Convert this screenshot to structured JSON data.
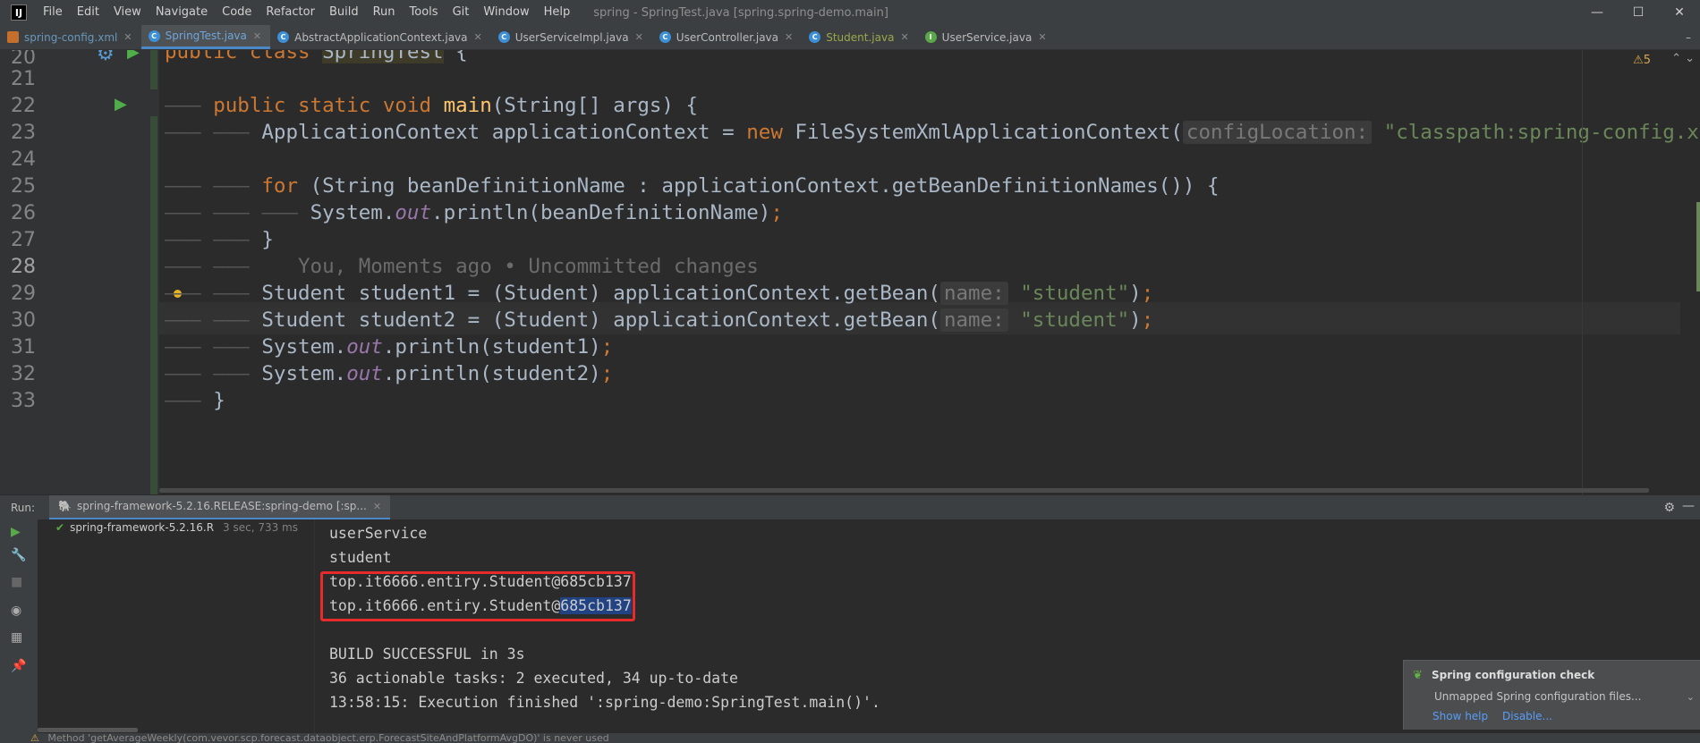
{
  "app": {
    "logo": "IJ",
    "window_title": "spring - SpringTest.java [spring.spring-demo.main]",
    "menu": [
      "File",
      "Edit",
      "View",
      "Navigate",
      "Code",
      "Refactor",
      "Build",
      "Run",
      "Tools",
      "Git",
      "Window",
      "Help"
    ],
    "controls": {
      "minimize": "—",
      "maximize": "☐",
      "close": "✕"
    }
  },
  "tabs": [
    {
      "label": "spring-config.xml",
      "icon": "xml-file-icon",
      "style": "blue",
      "glyph": ""
    },
    {
      "label": "SpringTest.java",
      "icon": "class-icon",
      "style": "active",
      "glyph": "C"
    },
    {
      "label": "AbstractApplicationContext.java",
      "icon": "class-icon",
      "style": "normal",
      "glyph": "C"
    },
    {
      "label": "UserServiceImpl.java",
      "icon": "class-icon",
      "style": "normal",
      "glyph": "C"
    },
    {
      "label": "UserController.java",
      "icon": "class-icon",
      "style": "normal",
      "glyph": "C"
    },
    {
      "label": "Student.java",
      "icon": "class-icon",
      "style": "green",
      "glyph": "C"
    },
    {
      "label": "UserService.java",
      "icon": "interface-icon",
      "style": "normal",
      "glyph": "I"
    }
  ],
  "editor": {
    "warnings": "⚠5",
    "line_numbers": [
      "20",
      "21",
      "22",
      "23",
      "24",
      "25",
      "26",
      "27",
      "28",
      "29",
      "30",
      "31",
      "32",
      "33"
    ],
    "current_line": "28",
    "blame": "You, Moments ago • Uncommitted changes",
    "hints": {
      "config_location": "configLocation:",
      "name": "name:"
    },
    "strings": {
      "classpath": "\"classpath:spring-config.xml\"",
      "student": "\"student\""
    }
  },
  "run": {
    "label": "Run:",
    "tab_label": "spring-framework-5.2.16.RELEASE:spring-demo [:sp...",
    "tree_item": "spring-framework-5.2.16.R",
    "tree_time": "3 sec, 733 ms",
    "console_lines": [
      "userService",
      "student",
      "top.it6666.entiry.Student@685cb137",
      "top.it6666.entiry.Student@",
      "",
      "BUILD SUCCESSFUL in 3s",
      "36 actionable tasks: 2 executed, 34 up-to-date",
      "13:58:15: Execution finished ':spring-demo:SpringTest.main()'."
    ],
    "selected_suffix": "685cb137"
  },
  "notification": {
    "title": "Spring configuration check",
    "body": "Unmapped Spring configuration files...",
    "show_help": "Show help",
    "disable": "Disable..."
  },
  "status": {
    "text": "Method 'getAverageWeekly(com.vevor.scp.forecast.dataobject.erp.ForecastSiteAndPlatformAvgDO)' is never used"
  }
}
